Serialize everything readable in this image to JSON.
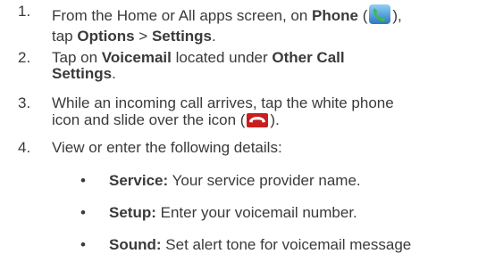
{
  "steps": [
    {
      "num": "1.",
      "line1_pre": "From the Home or All apps screen, on ",
      "line1_bold": "Phone",
      "line1_paren_open": " (",
      "line1_paren_close": "),",
      "line2_pre": "tap ",
      "line2_bold1": "Options",
      "line2_sep": " > ",
      "line2_bold2": "Settings",
      "line2_end": "."
    },
    {
      "num": "2.",
      "line1_pre": "Tap on ",
      "line1_bold1": "Voicemail",
      "line1_mid": " located under ",
      "line1_bold2": "Other Call",
      "line2_bold": "Settings",
      "line2_end": "."
    },
    {
      "num": "3.",
      "line1": "While an incoming call arrives, tap the white phone",
      "line2_pre": "icon and slide over the icon (",
      "line2_end": ")."
    },
    {
      "num": "4.",
      "line1": "View or enter the following details:"
    }
  ],
  "bullets": [
    {
      "mark": "•",
      "label": "Service:",
      "text": " Your service provider name."
    },
    {
      "mark": "•",
      "label": "Setup:",
      "text": " Enter your voicemail number."
    },
    {
      "mark": "•",
      "label": "Sound:",
      "text": " Set alert tone for voicemail message"
    }
  ],
  "icons": {
    "phone_app": "phone-app-icon",
    "end_call": "end-call-icon"
  },
  "colors": {
    "text": "#3a3a3a",
    "phone_icon": "#3a8fd0",
    "end_call_icon": "#c81e1e"
  }
}
